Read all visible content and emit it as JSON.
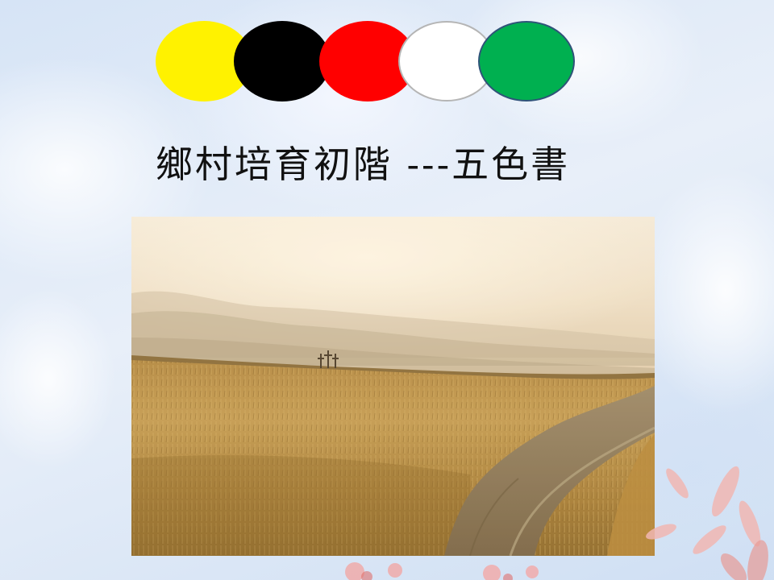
{
  "title": {
    "text": "鄉村培育初階 ---五色書"
  },
  "color_dots": [
    {
      "name": "yellow",
      "color": "#fff200"
    },
    {
      "name": "black",
      "color": "#000000"
    },
    {
      "name": "red",
      "color": "#ff0000"
    },
    {
      "name": "white",
      "color": "#ffffff"
    },
    {
      "name": "green",
      "color": "#00b050"
    }
  ],
  "photo": {
    "subject": "wheat-field-with-dirt-road-and-three-crosses"
  }
}
